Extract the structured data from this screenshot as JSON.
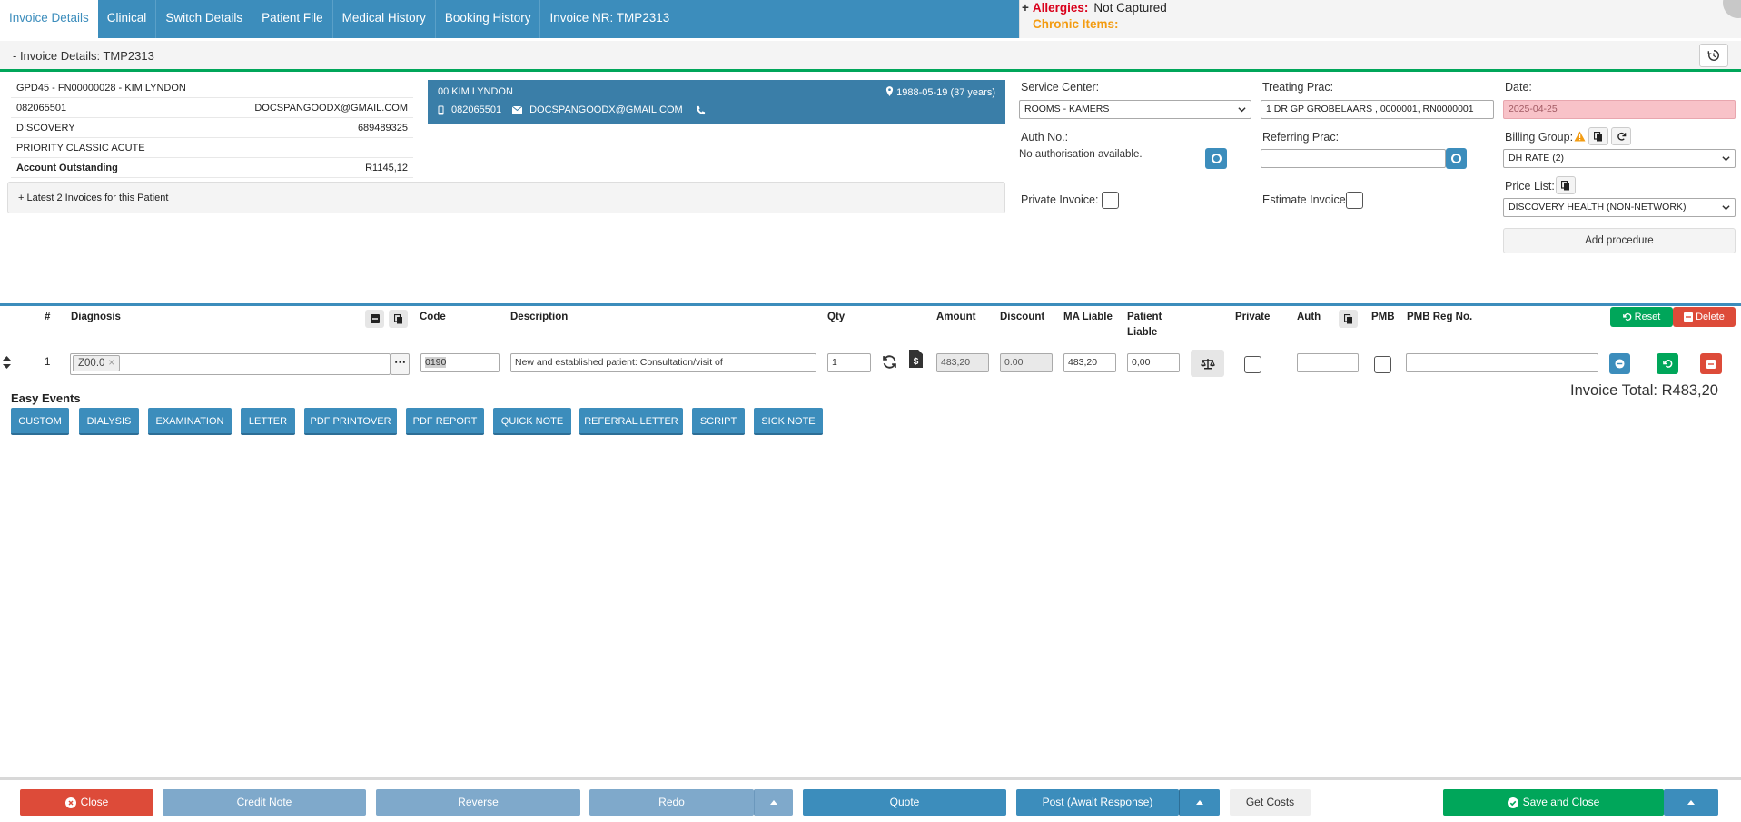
{
  "tabs": [
    {
      "label": "Invoice Details"
    },
    {
      "label": "Clinical"
    },
    {
      "label": "Switch Details"
    },
    {
      "label": "Patient File"
    },
    {
      "label": "Medical History"
    },
    {
      "label": "Booking History"
    },
    {
      "label": "Invoice NR: TMP2313"
    }
  ],
  "alerts": {
    "allergies_label": "Allergies:",
    "allergies_value": "Not Captured",
    "chronic_label": "Chronic Items:"
  },
  "section": {
    "title": "- Invoice Details: TMP2313"
  },
  "patient": {
    "id_line": "GPD45 -  FN00000028  -  KIM LYNDON",
    "phone": "082065501",
    "email": "DOCSPANGOODX@GMAIL.COM",
    "medical_aid": "DISCOVERY",
    "member_no": "689489325",
    "plan": "PRIORITY CLASSIC ACUTE",
    "outstanding_label": "Account Outstanding",
    "outstanding_value": "R1145,12",
    "latest_invoices": "+ Latest 2 Invoices for this Patient"
  },
  "card": {
    "name": "00 KIM LYNDON",
    "dob": "1988-05-19 (37 years)",
    "phone": "082065501",
    "email": "DOCSPANGOODX@GMAIL.COM"
  },
  "form": {
    "service_center_label": "Service Center:",
    "service_center_value": "ROOMS - KAMERS",
    "treating_prac_label": "Treating Prac:",
    "treating_prac_value": "1 DR GP GROBELAARS , 0000001, RN0000001",
    "date_label": "Date:",
    "date_value": "2025-04-25",
    "auth_label": "Auth No.:",
    "auth_value": "No authorisation available.",
    "referring_label": "Referring Prac:",
    "billing_label": "Billing Group:",
    "billing_value": "DH RATE (2)",
    "private_label": "Private Invoice:",
    "estimate_label": "Estimate Invoice:",
    "price_list_label": "Price List:",
    "price_list_value": "DISCOVERY HEALTH (NON-NETWORK)",
    "add_procedure": "Add procedure"
  },
  "table": {
    "headers": {
      "num": "#",
      "diagnosis": "Diagnosis",
      "code": "Code",
      "description": "Description",
      "qty": "Qty",
      "amount": "Amount",
      "discount": "Discount",
      "ma_liable": "MA Liable",
      "patient_liable_1": "Patient",
      "patient_liable_2": "Liable",
      "private": "Private",
      "auth": "Auth",
      "pmb": "PMB",
      "pmb_reg": "PMB Reg No."
    },
    "reset_label": "Reset",
    "delete_label": "Delete",
    "row": {
      "num": "1",
      "diagnosis_tag": "Z00.0",
      "code": "0190",
      "description": "New and established patient: Consultation/visit of",
      "qty": "1",
      "amount": "483,20",
      "discount": "0.00",
      "ma_liable": "483,20",
      "patient_liable": "0,00"
    }
  },
  "easy_events": {
    "title": "Easy Events",
    "buttons": [
      "CUSTOM",
      "DIALYSIS",
      "EXAMINATION",
      "LETTER",
      "PDF PRINTOVER",
      "PDF REPORT",
      "QUICK NOTE",
      "REFERRAL LETTER",
      "SCRIPT",
      "SICK NOTE"
    ]
  },
  "invoice_total": "Invoice Total: R483,20",
  "footer": {
    "close": "Close",
    "credit_note": "Credit Note",
    "reverse": "Reverse",
    "redo": "Redo",
    "quote": "Quote",
    "post": "Post (Await Response)",
    "get_costs": "Get Costs",
    "save_close": "Save and Close"
  },
  "colors": {
    "primary": "#3c8dbc",
    "success": "#00a65a",
    "danger": "#dd4b39",
    "warning": "#f39c12",
    "allergy": "#d9001b"
  }
}
